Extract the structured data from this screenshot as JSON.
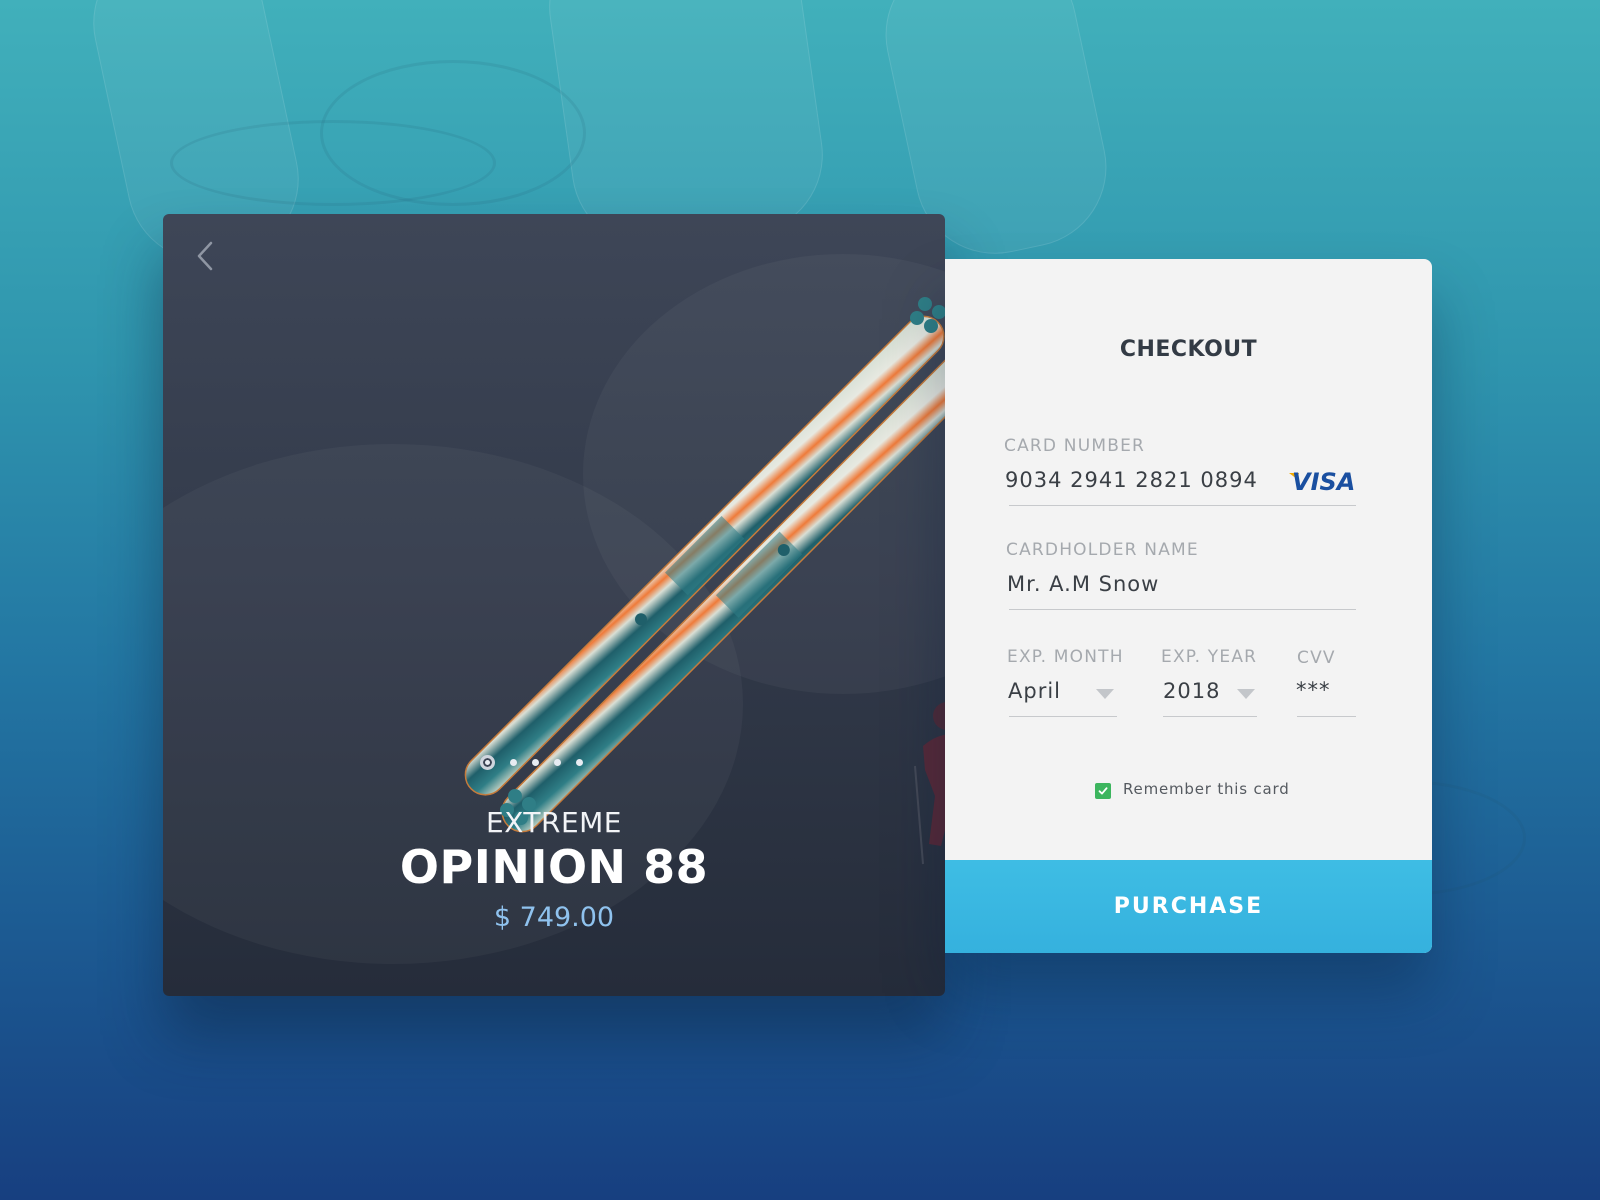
{
  "product": {
    "category": "EXTREME",
    "name": "OPINION 88",
    "price": "$ 749.00",
    "carousel": {
      "total": 5,
      "active": 1
    },
    "back_icon": "chevron-left-icon"
  },
  "checkout": {
    "title": "CHECKOUT",
    "card_number": {
      "label": "CARD NUMBER",
      "value": "9034 2941 2821 0894",
      "brand": "VISA"
    },
    "cardholder": {
      "label": "CARDHOLDER NAME",
      "value": "Mr. A.M Snow"
    },
    "exp_month": {
      "label": "EXP. MONTH",
      "value": "April"
    },
    "exp_year": {
      "label": "EXP. YEAR",
      "value": "2018"
    },
    "cvv": {
      "label": "CVV",
      "value": "***"
    },
    "remember": {
      "label": "Remember this card",
      "checked": true
    },
    "purchase_label": "PURCHASE"
  },
  "colors": {
    "accent": "#3ebde4",
    "price": "#8fc2ee",
    "checkbox": "#3cb55e",
    "visa_blue": "#1a4fa0",
    "visa_gold": "#f2a900"
  }
}
